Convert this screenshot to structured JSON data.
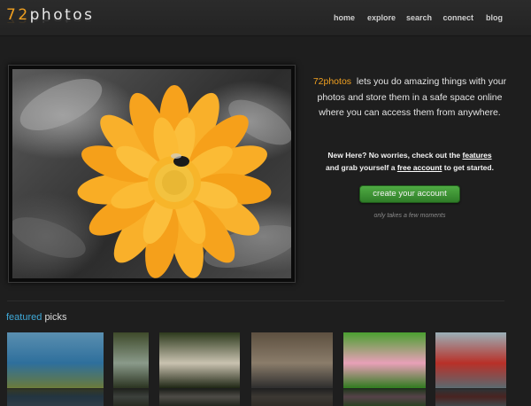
{
  "header": {
    "logo_num": "72",
    "logo_word": "photos",
    "nav": [
      "home",
      "explore",
      "search",
      "connect",
      "blog"
    ]
  },
  "hero": {
    "image": "orange flower on black and white background"
  },
  "intro": {
    "brand": "72photos",
    "text": "lets you do amazing things with your photos and store them in a safe space online where you can access them from anywhere."
  },
  "newhere": {
    "prefix": "New Here? No worries, check out the",
    "features_link": "features",
    "middle": "and grab yourself a",
    "free_account_link": "free account",
    "suffix": "to get started."
  },
  "cta": {
    "label": "create your account",
    "note": "only takes a few moments"
  },
  "featured": {
    "highlight": "featured",
    "rest": "picks",
    "thumbs": [
      {
        "name": "lake-tower-thumb",
        "colors": [
          "#5a8fb0",
          "#2e6f9c",
          "#6b7a3a"
        ]
      },
      {
        "name": "waterfall-thumb",
        "colors": [
          "#3e4a2a",
          "#8a9a8a",
          "#2a3320"
        ]
      },
      {
        "name": "mushrooms-thumb",
        "colors": [
          "#2d3a1d",
          "#c9c2b0",
          "#1e2614"
        ]
      },
      {
        "name": "road-mesa-thumb",
        "colors": [
          "#5d5040",
          "#8a7c6a",
          "#2d2d2d"
        ]
      },
      {
        "name": "pink-flower-thumb",
        "colors": [
          "#4aa030",
          "#e8a0b8",
          "#2f7a1e"
        ]
      },
      {
        "name": "child-thumb",
        "colors": [
          "#9ab0b8",
          "#b83028",
          "#5a6a70"
        ]
      }
    ]
  },
  "colors": {
    "accent_orange": "#f0a020",
    "accent_blue": "#3fa9d8",
    "cta_green": "#3f9535"
  }
}
